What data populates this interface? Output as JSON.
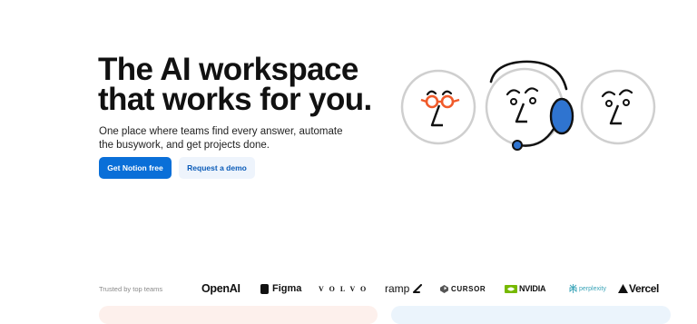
{
  "hero": {
    "title": "The AI workspace that works for you.",
    "subtitle": "One place where teams find every answer, automate the busywork, and get projects done.",
    "primary_cta": "Get Notion free",
    "secondary_cta": "Request a demo"
  },
  "trusted": {
    "label": "Trusted by top teams",
    "logos": [
      "OpenAI",
      "Figma",
      "VOLVO",
      "ramp",
      "CURSOR",
      "NVIDIA",
      "perplexity",
      "Vercel"
    ]
  },
  "colors": {
    "primary": "#0a6fd8",
    "secondary_bg": "#eef4fc",
    "accent_orange": "#f05a2a",
    "accent_blue": "#2f74d0",
    "card_left": "#fdf0ec",
    "card_right": "#ebf4fc"
  },
  "icons": [
    "face-with-glasses-icon",
    "face-with-headset-icon",
    "face-icon",
    "figma-logo-icon",
    "ramp-logo-icon",
    "cursor-logo-icon",
    "nvidia-logo-icon",
    "perplexity-logo-icon",
    "vercel-triangle-icon"
  ]
}
